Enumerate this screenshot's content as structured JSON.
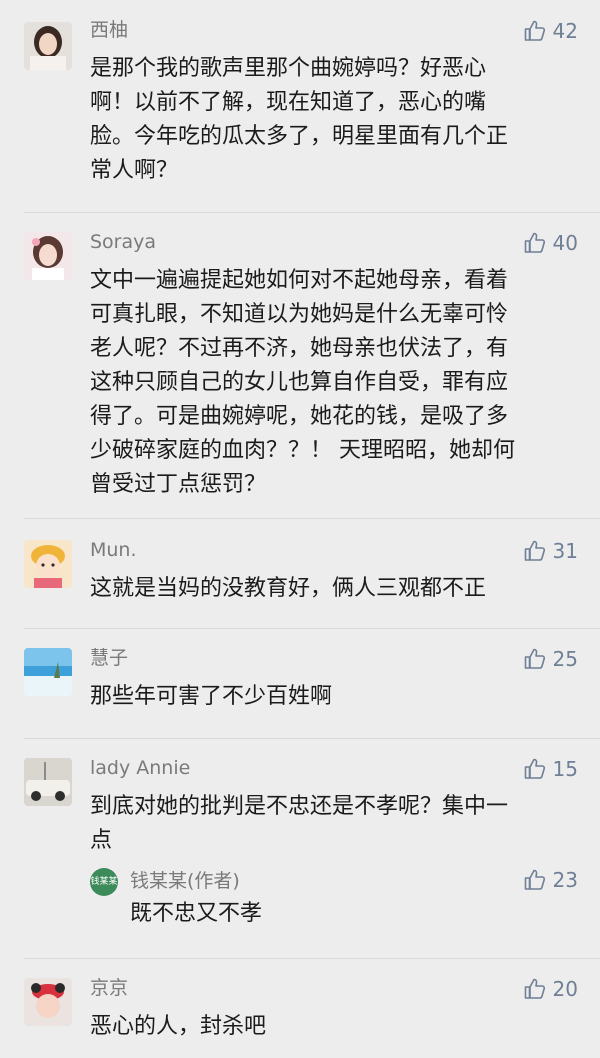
{
  "comments": [
    {
      "name": "西柚",
      "likes": "42",
      "text": "是那个我的歌声里那个曲婉婷吗？好恶心\n啊！以前不了解，现在知道了，恶心的嘴\n脸。今年吃的瓜太多了，明星里面有几个正\n常人啊？"
    },
    {
      "name": "Soraya",
      "likes": "40",
      "text": "文中一遍遍提起她如何对不起她母亲，看着\n可真扎眼，不知道以为她妈是什么无辜可怜\n老人呢？不过再不济，她母亲也伏法了，有\n这种只顾自己的女儿也算自作自受，罪有应\n得了。可是曲婉婷呢，她花的钱，是吸了多\n少破碎家庭的血肉？？！ 天理昭昭，她却何\n曾受过丁点惩罚？"
    },
    {
      "name": "Mun.",
      "likes": "31",
      "text": "这就是当妈的没教育好，俩人三观都不正"
    },
    {
      "name": "慧子",
      "likes": "25",
      "text": "那些年可害了不少百姓啊"
    },
    {
      "name": "lady Annie",
      "likes": "15",
      "text": "到底对她的批判是不忠还是不孝呢？集中一\n点",
      "reply": {
        "avatar_text": "钱某某",
        "name": "钱某某(作者)",
        "likes": "23",
        "text": "既不忠又不孝"
      }
    },
    {
      "name": "京京",
      "likes": "20",
      "text": "恶心的人，封杀吧"
    }
  ],
  "icons": {
    "like": "thumbs-up-icon"
  },
  "colors": {
    "background": "#ededed",
    "like": "#6f7f95",
    "reply_avatar": "#3d8a5a"
  }
}
